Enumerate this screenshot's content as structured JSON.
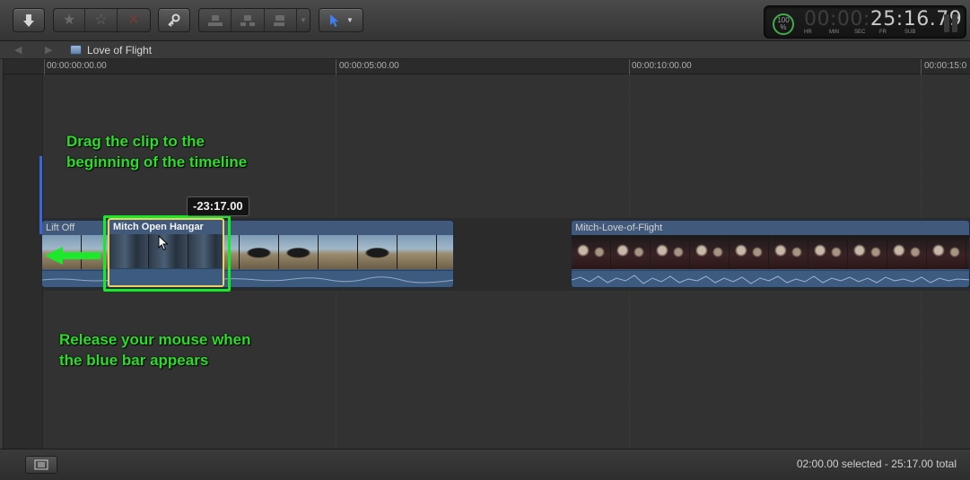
{
  "toolbar": {
    "icons": [
      "import-icon",
      "favorite-icon",
      "unrate-icon",
      "reject-icon",
      "keyword-icon",
      "connect-clip-icon",
      "insert-clip-icon",
      "append-clip-icon",
      "select-tool-icon"
    ]
  },
  "timecode": {
    "percent": "100",
    "percent_unit": "%",
    "dim_digits": "00:00:",
    "digits": "25:16.79",
    "units": [
      "HR",
      "MIN",
      "SEC",
      "FR",
      "SUB"
    ],
    "accent_color": "#3fae4a"
  },
  "project": {
    "title": "Love of Flight"
  },
  "ruler": {
    "labels": [
      "00:00:00:00.00",
      "00:00:05:00.00",
      "00:00:10:00.00",
      "00:00:15:0"
    ]
  },
  "clips": {
    "lift_off": {
      "name": "Lift Off"
    },
    "mitch_love": {
      "name": "Mitch-Love-of-Flight"
    },
    "dragged": {
      "name": "Mitch Open Hangar",
      "offset": "-23:17.00"
    }
  },
  "annotations": {
    "top": "Drag the clip to the\nbeginning of the timeline",
    "bottom": "Release your mouse when\nthe blue bar appears",
    "color": "#2ddc2a"
  },
  "footer": {
    "status": "02:00.00 selected - 25:17.00 total"
  }
}
